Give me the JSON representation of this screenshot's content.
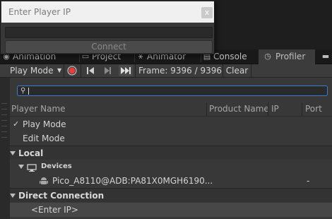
{
  "dialog": {
    "title": "Enter Player IP",
    "close_glyph": "x",
    "ip_value": "",
    "connect_label": "Connect"
  },
  "tabs": [
    {
      "label": "Animation",
      "icon": "animation-icon"
    },
    {
      "label": "Project",
      "icon": "folder-icon"
    },
    {
      "label": "Animator",
      "icon": "animator-icon"
    },
    {
      "label": "Console",
      "icon": "console-icon"
    },
    {
      "label": "Profiler",
      "icon": "profiler-icon"
    }
  ],
  "toolbar": {
    "mode_label": "Play Mode",
    "frame_label": "Frame: 9396 / 9396",
    "clear_label": "Clear"
  },
  "search": {
    "value": ""
  },
  "list": {
    "headers": {
      "player_name": "Player Name",
      "product_name": "Product Name",
      "ip": "IP",
      "port": "Port"
    },
    "play_mode": {
      "check": "✓",
      "label": "Play Mode"
    },
    "edit_mode": {
      "label": "Edit Mode"
    },
    "local_section": "Local",
    "devices_label": "Devices",
    "device": {
      "name": "Pico_A8110@ADB:PA81X0MGH6190...",
      "port": "-"
    },
    "direct_section": "Direct Connection",
    "enter_ip_item": "<Enter IP>"
  },
  "colors": {
    "accent": "#3a7bd5",
    "record": "#e04040",
    "panel": "#383838"
  }
}
